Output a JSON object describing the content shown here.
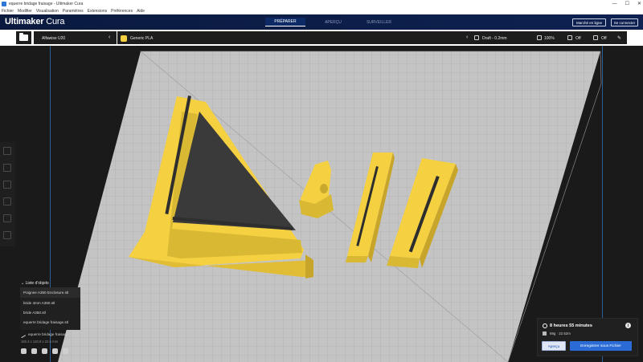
{
  "window": {
    "title": "equerre bridage fraisage - Ultimaker Cura",
    "controls": [
      "—",
      "☐",
      "✕"
    ]
  },
  "menu": [
    "Fichier",
    "Modifier",
    "Visualisation",
    "Paramètres",
    "Extensions",
    "Préférences",
    "Aide"
  ],
  "header": {
    "logo_bold": "Ultimaker",
    "logo_light": "Cura",
    "stages": [
      "PRÉPARER",
      "APERÇU",
      "SURVEILLER"
    ],
    "active_stage": "PRÉPARER",
    "marketplace_label": "Marché en ligne",
    "signin_label": "Se connecter"
  },
  "toolbar": {
    "printer": "Alfawise U20",
    "material": "Generic PLA",
    "profile": "Draft - 0.2mm",
    "infill": "100%",
    "support": "Off",
    "adhesion": "Off"
  },
  "objects": {
    "header": "Liste d'objets",
    "items": [
      "Poignee A350 Enclosure.stl",
      "bride 4mm A350.stl",
      "bride A350.stl",
      "equerre bridage fraisage.stl"
    ],
    "selected_index": 0
  },
  "project": {
    "name": "equerre bridage fraisage",
    "dimensions": "150.3 x 120.8 x 22.5 mm"
  },
  "print": {
    "time": "8 heures 55 minutes",
    "material_usage": "69g · 22.52m",
    "preview_label": "Aperçu",
    "save_label": "Enregistrer sous Fichier"
  },
  "colors": {
    "header_bg": "#0e2151",
    "plate": "#c4c4c4",
    "model": "#f5d142",
    "accent": "#2a6bd6"
  }
}
